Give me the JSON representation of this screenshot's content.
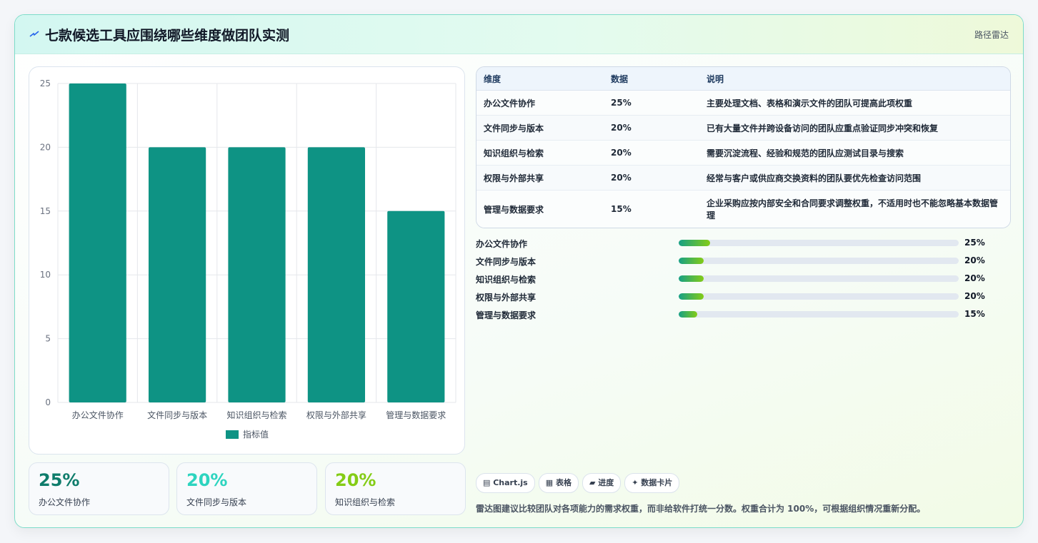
{
  "header": {
    "icon": "lightning-icon",
    "title": "七款候选工具应围绕哪些维度做团队实测",
    "right_label": "路径雷达"
  },
  "chart_data": {
    "type": "bar",
    "categories": [
      "办公文件协作",
      "文件同步与版本",
      "知识组织与检索",
      "权限与外部共享",
      "管理与数据要求"
    ],
    "series": [
      {
        "name": "指标值",
        "values": [
          25,
          20,
          20,
          20,
          15
        ],
        "color": "#0e9384"
      }
    ],
    "ylim": [
      0,
      25
    ],
    "yticks": [
      0,
      5,
      10,
      15,
      20,
      25
    ],
    "grid": true,
    "legend": "bottom"
  },
  "stats": [
    {
      "value": "25%",
      "label": "办公文件协作",
      "color": "#0e7c6b"
    },
    {
      "value": "20%",
      "label": "文件同步与版本",
      "color": "#2dd4bf"
    },
    {
      "value": "20%",
      "label": "知识组织与检索",
      "color": "#84cc16"
    }
  ],
  "table": {
    "headers": [
      "维度",
      "数据",
      "说明"
    ],
    "rows": [
      [
        "办公文件协作",
        "25%",
        "主要处理文档、表格和演示文件的团队可提高此项权重"
      ],
      [
        "文件同步与版本",
        "20%",
        "已有大量文件并跨设备访问的团队应重点验证同步冲突和恢复"
      ],
      [
        "知识组织与检索",
        "20%",
        "需要沉淀流程、经验和规范的团队应测试目录与搜索"
      ],
      [
        "权限与外部共享",
        "20%",
        "经常与客户或供应商交换资料的团队要优先检查访问范围"
      ],
      [
        "管理与数据要求",
        "15%",
        "企业采购应按内部安全和合同要求调整权重，不适用时也不能忽略基本数据管理"
      ]
    ]
  },
  "progress": [
    {
      "label": "办公文件协作",
      "value": "25%",
      "fraction": 0.25
    },
    {
      "label": "文件同步与版本",
      "value": "20%",
      "fraction": 0.2
    },
    {
      "label": "知识组织与检索",
      "value": "20%",
      "fraction": 0.2
    },
    {
      "label": "权限与外部共享",
      "value": "20%",
      "fraction": 0.2
    },
    {
      "label": "管理与数据要求",
      "value": "15%",
      "fraction": 0.15
    }
  ],
  "progress_scale_max": 2.22,
  "chips": [
    "▤ Chart.js",
    "▦ 表格",
    "▰ 进度",
    "✦ 数据卡片"
  ],
  "note": "雷达图建议比较团队对各项能力的需求权重，而非给软件打统一分数。权重合计为 100%，可根据组织情况重新分配。"
}
